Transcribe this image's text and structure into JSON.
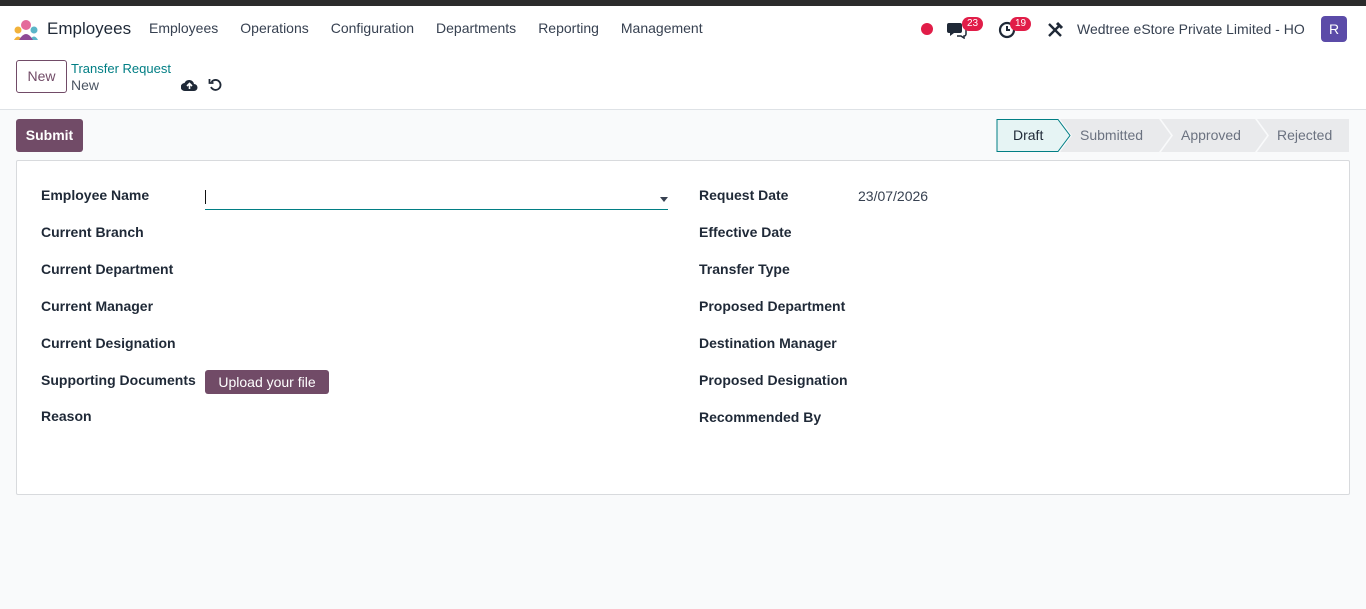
{
  "app": {
    "name": "Employees"
  },
  "menu": [
    "Employees",
    "Operations",
    "Configuration",
    "Departments",
    "Reporting",
    "Management"
  ],
  "systray": {
    "messages_count": "23",
    "activities_count": "19",
    "company": "Wedtree eStore Private Limited - HO",
    "avatar_initial": "R"
  },
  "control": {
    "new_label": "New",
    "breadcrumb_parent": "Transfer Request",
    "breadcrumb_current": "New"
  },
  "actions": {
    "submit_label": "Submit"
  },
  "statusbar": {
    "stages": [
      "Draft",
      "Submitted",
      "Approved",
      "Rejected"
    ],
    "active": "Draft"
  },
  "form": {
    "left": {
      "employee_name": "Employee Name",
      "current_branch": "Current Branch",
      "current_department": "Current Department",
      "current_manager": "Current Manager",
      "current_designation": "Current Designation",
      "supporting_documents": "Supporting Documents",
      "upload_label": "Upload your file",
      "reason": "Reason"
    },
    "right": {
      "request_date": "Request Date",
      "request_date_value": "23/07/2026",
      "effective_date": "Effective Date",
      "transfer_type": "Transfer Type",
      "proposed_department": "Proposed Department",
      "destination_manager": "Destination Manager",
      "proposed_designation": "Proposed Designation",
      "recommended_by": "Recommended By"
    }
  },
  "colors": {
    "brand": "#714b67",
    "accent": "#017e84",
    "badge": "#e11d48",
    "avatar": "#5b4ba8"
  }
}
